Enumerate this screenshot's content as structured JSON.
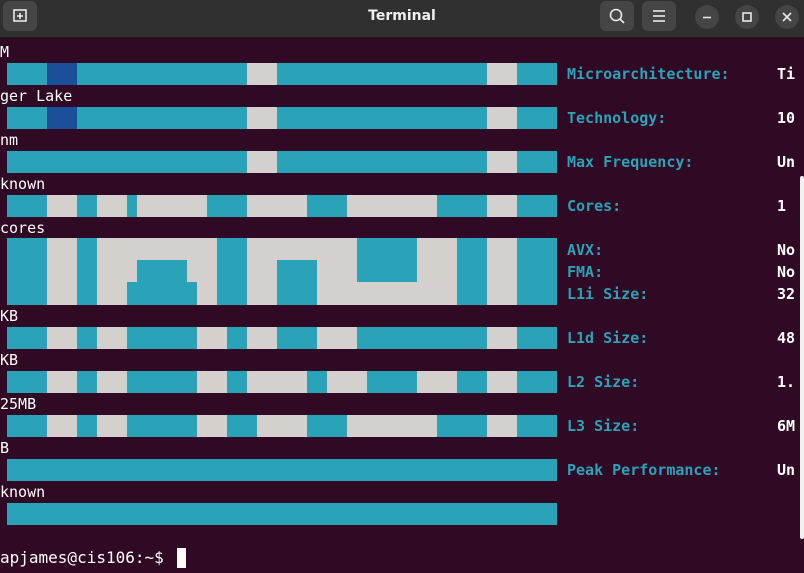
{
  "window": {
    "title": "Terminal",
    "buttons": {
      "new_tab_icon": "new-tab-icon",
      "search_icon": "search-icon",
      "menu_icon": "hamburger-icon",
      "minimize_icon": "minimize-icon",
      "maximize_icon": "maximize-icon",
      "close_icon": "close-icon"
    }
  },
  "terminal": {
    "left_lines": [
      "M",
      "ger Lake",
      "nm",
      "known",
      "cores",
      "KB",
      "KB",
      "25MB",
      "B",
      "known"
    ],
    "info": [
      {
        "label": "Microarchitecture:",
        "value": "Ti"
      },
      {
        "label": "Technology:",
        "value": "10"
      },
      {
        "label": "Max Frequency:",
        "value": "Un"
      },
      {
        "label": "Cores:",
        "value": "1"
      },
      {
        "label": "AVX:",
        "value": "No"
      },
      {
        "label": "FMA:",
        "value": "No"
      },
      {
        "label": "L1i Size:",
        "value": "32"
      },
      {
        "label": "L1d Size:",
        "value": "48"
      },
      {
        "label": "L2 Size:",
        "value": "1."
      },
      {
        "label": "L3 Size:",
        "value": "6M"
      },
      {
        "label": "Peak Performance:",
        "value": "Un"
      }
    ],
    "prompt": "apjames@cis106:~$ "
  },
  "colors": {
    "background": "#300a24",
    "accent": "#2aa3b8",
    "light": "#d3d0ce",
    "dark_blue": "#1b4f99"
  }
}
